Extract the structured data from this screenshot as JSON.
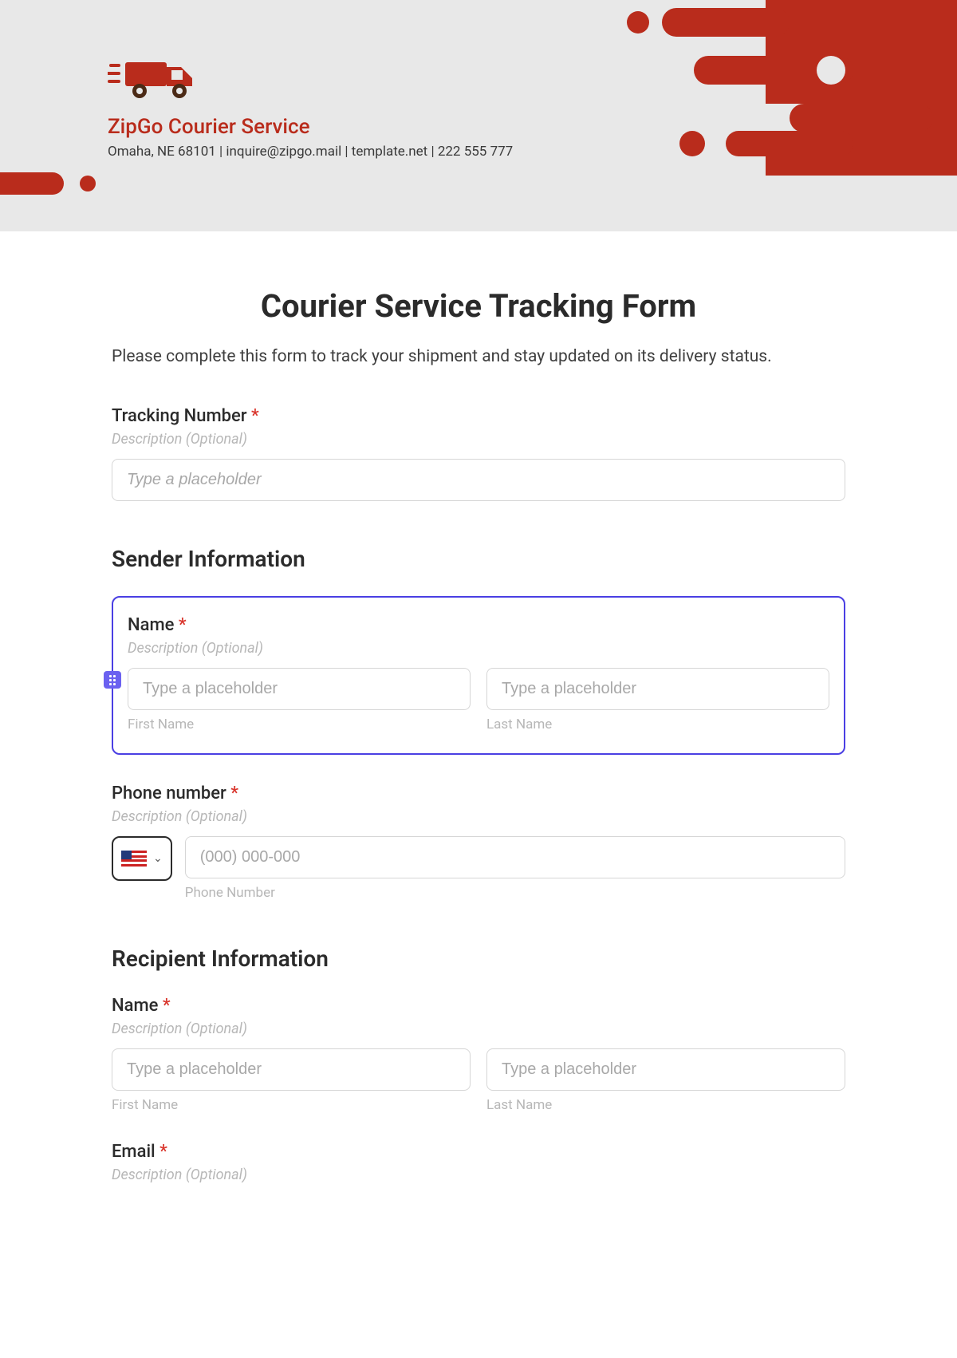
{
  "header": {
    "brand_name": "ZipGo Courier Service",
    "brand_sub": "Omaha, NE 68101 | inquire@zipgo.mail | template.net | 222 555 777"
  },
  "form": {
    "title": "Courier Service Tracking Form",
    "intro": "Please complete this form to track your shipment and stay updated on its delivery status.",
    "desc_optional": "Description (Optional)",
    "tracking": {
      "label": "Tracking Number",
      "placeholder": "Type a placeholder"
    },
    "sender": {
      "heading": "Sender Information",
      "name_label": "Name",
      "first_placeholder": "Type a placeholder",
      "last_placeholder": "Type a placeholder",
      "first_sub": "First Name",
      "last_sub": "Last Name",
      "phone_label": "Phone number",
      "phone_placeholder": "(000) 000-000",
      "phone_sub": "Phone Number"
    },
    "recipient": {
      "heading": "Recipient Information",
      "name_label": "Name",
      "first_placeholder": "Type a placeholder",
      "last_placeholder": "Type a placeholder",
      "first_sub": "First Name",
      "last_sub": "Last Name",
      "email_label": "Email"
    }
  },
  "colors": {
    "brand_red": "#b92c1c",
    "accent_blue": "#4a3fe3"
  }
}
